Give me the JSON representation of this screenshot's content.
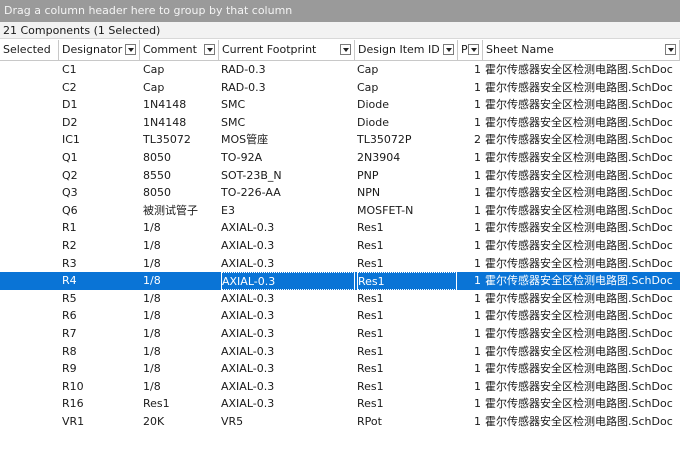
{
  "group_bar": {
    "text": "Drag a column header here to group by that column"
  },
  "summary": {
    "text": "21 Components (1 Selected)"
  },
  "columns": [
    {
      "label": "Selected"
    },
    {
      "label": "Designator"
    },
    {
      "label": "Comment"
    },
    {
      "label": "Current Footprint"
    },
    {
      "label": "Design Item ID"
    },
    {
      "label": "P"
    },
    {
      "label": "Sheet Name"
    }
  ],
  "rows": [
    {
      "designator": "C1",
      "comment": "Cap",
      "footprint": "RAD-0.3",
      "item": "Cap",
      "qty": "1",
      "sheet": "霍尔传感器安全区检测电路图.SchDoc",
      "selected": false
    },
    {
      "designator": "C2",
      "comment": "Cap",
      "footprint": "RAD-0.3",
      "item": "Cap",
      "qty": "1",
      "sheet": "霍尔传感器安全区检测电路图.SchDoc",
      "selected": false
    },
    {
      "designator": "D1",
      "comment": "1N4148",
      "footprint": "SMC",
      "item": "Diode",
      "qty": "1",
      "sheet": "霍尔传感器安全区检测电路图.SchDoc",
      "selected": false
    },
    {
      "designator": "D2",
      "comment": "1N4148",
      "footprint": "SMC",
      "item": "Diode",
      "qty": "1",
      "sheet": "霍尔传感器安全区检测电路图.SchDoc",
      "selected": false
    },
    {
      "designator": "IC1",
      "comment": "TL35072",
      "footprint": "MOS管座",
      "item": "TL35072P",
      "qty": "2",
      "sheet": "霍尔传感器安全区检测电路图.SchDoc",
      "selected": false
    },
    {
      "designator": "Q1",
      "comment": "8050",
      "footprint": "TO-92A",
      "item": "2N3904",
      "qty": "1",
      "sheet": "霍尔传感器安全区检测电路图.SchDoc",
      "selected": false
    },
    {
      "designator": "Q2",
      "comment": "8550",
      "footprint": "SOT-23B_N",
      "item": "PNP",
      "qty": "1",
      "sheet": "霍尔传感器安全区检测电路图.SchDoc",
      "selected": false
    },
    {
      "designator": "Q3",
      "comment": "8050",
      "footprint": "TO-226-AA",
      "item": "NPN",
      "qty": "1",
      "sheet": "霍尔传感器安全区检测电路图.SchDoc",
      "selected": false
    },
    {
      "designator": "Q6",
      "comment": "被测试管子",
      "footprint": "E3",
      "item": "MOSFET-N",
      "qty": "1",
      "sheet": "霍尔传感器安全区检测电路图.SchDoc",
      "selected": false
    },
    {
      "designator": "R1",
      "comment": "1/8",
      "footprint": " AXIAL-0.3",
      "item": "Res1",
      "qty": "1",
      "sheet": "霍尔传感器安全区检测电路图.SchDoc",
      "selected": false
    },
    {
      "designator": "R2",
      "comment": "1/8",
      "footprint": " AXIAL-0.3",
      "item": "Res1",
      "qty": "1",
      "sheet": "霍尔传感器安全区检测电路图.SchDoc",
      "selected": false
    },
    {
      "designator": "R3",
      "comment": "1/8",
      "footprint": " AXIAL-0.3",
      "item": "Res1",
      "qty": "1",
      "sheet": "霍尔传感器安全区检测电路图.SchDoc",
      "selected": false
    },
    {
      "designator": "R4",
      "comment": "1/8",
      "footprint": " AXIAL-0.3",
      "item": "Res1",
      "qty": "1",
      "sheet": "霍尔传感器安全区检测电路图.SchDoc",
      "selected": true
    },
    {
      "designator": "R5",
      "comment": "1/8",
      "footprint": " AXIAL-0.3",
      "item": "Res1",
      "qty": "1",
      "sheet": "霍尔传感器安全区检测电路图.SchDoc",
      "selected": false
    },
    {
      "designator": "R6",
      "comment": "1/8",
      "footprint": " AXIAL-0.3",
      "item": "Res1",
      "qty": "1",
      "sheet": "霍尔传感器安全区检测电路图.SchDoc",
      "selected": false
    },
    {
      "designator": "R7",
      "comment": "1/8",
      "footprint": " AXIAL-0.3",
      "item": "Res1",
      "qty": "1",
      "sheet": "霍尔传感器安全区检测电路图.SchDoc",
      "selected": false
    },
    {
      "designator": "R8",
      "comment": "1/8",
      "footprint": " AXIAL-0.3",
      "item": "Res1",
      "qty": "1",
      "sheet": "霍尔传感器安全区检测电路图.SchDoc",
      "selected": false
    },
    {
      "designator": "R9",
      "comment": "1/8",
      "footprint": " AXIAL-0.3",
      "item": "Res1",
      "qty": "1",
      "sheet": "霍尔传感器安全区检测电路图.SchDoc",
      "selected": false
    },
    {
      "designator": "R10",
      "comment": "1/8",
      "footprint": " AXIAL-0.3",
      "item": "Res1",
      "qty": "1",
      "sheet": "霍尔传感器安全区检测电路图.SchDoc",
      "selected": false
    },
    {
      "designator": "R16",
      "comment": "Res1",
      "footprint": " AXIAL-0.3",
      "item": "Res1",
      "qty": "1",
      "sheet": "霍尔传感器安全区检测电路图.SchDoc",
      "selected": false
    },
    {
      "designator": "VR1",
      "comment": "20K",
      "footprint": "VR5",
      "item": "RPot",
      "qty": "1",
      "sheet": "霍尔传感器安全区检测电路图.SchDoc",
      "selected": false
    }
  ]
}
